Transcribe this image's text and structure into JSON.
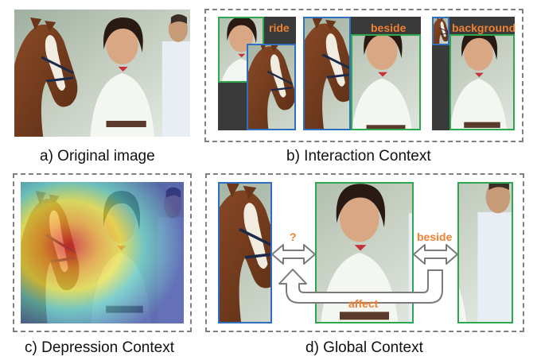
{
  "captions": {
    "a": "a) Original image",
    "b": "b) Interaction Context",
    "c": "c) Depression Context",
    "d": "d) Global Context"
  },
  "labels": {
    "ride": "ride",
    "beside_b": "beside",
    "background": "background",
    "question": "?",
    "beside_d": "beside",
    "affect": "affect"
  },
  "colors": {
    "label_orange": "#f08030",
    "box_green": "#2ea84f",
    "box_blue": "#2e6fc0",
    "dashed_gray": "#7f7f7f",
    "dark_panel": "#3a3a3a"
  }
}
